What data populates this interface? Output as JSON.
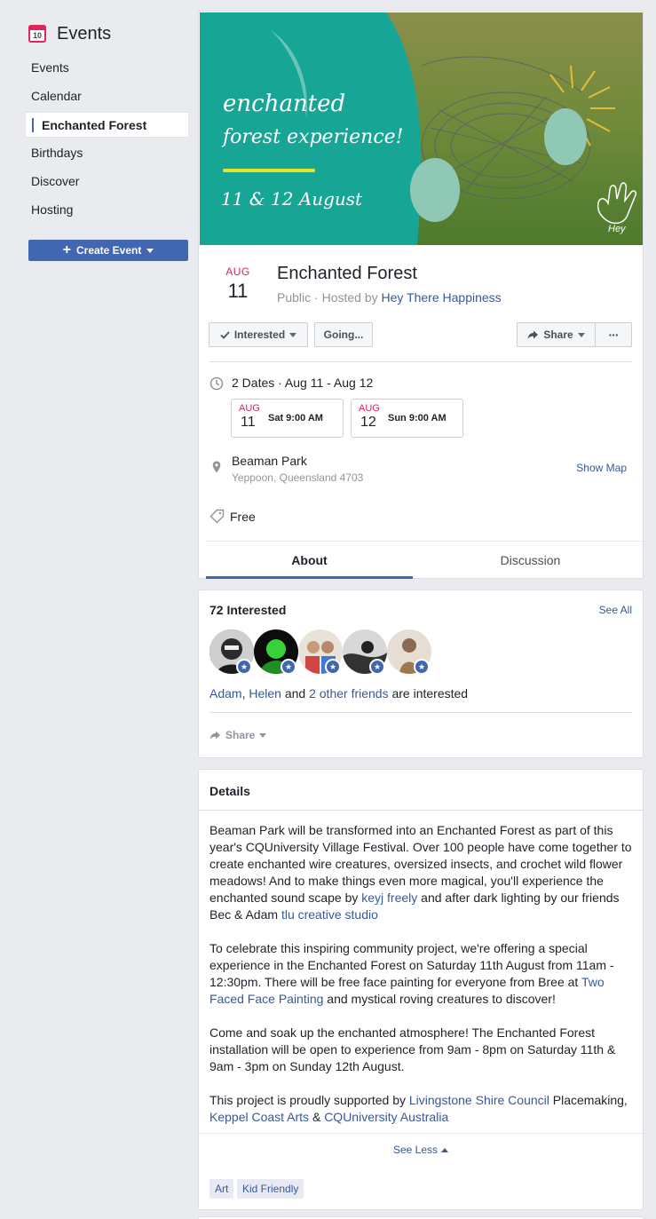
{
  "sidebar": {
    "title": "Events",
    "icon_day": "10",
    "items": [
      {
        "label": "Events"
      },
      {
        "label": "Calendar"
      },
      {
        "label": "Enchanted Forest"
      },
      {
        "label": "Birthdays"
      },
      {
        "label": "Discover"
      },
      {
        "label": "Hosting"
      }
    ],
    "create_label": "Create Event"
  },
  "event": {
    "cover": {
      "line1": "enchanted",
      "line2": "forest experience!",
      "dates": "11 & 12 August",
      "logo_text": "Hey"
    },
    "month": "AUG",
    "day": "11",
    "title": "Enchanted Forest",
    "privacy": "Public",
    "hosted_prefix": " · Hosted by ",
    "host": "Hey There Happiness",
    "buttons": {
      "interested": "Interested",
      "going": "Going...",
      "share": "Share",
      "more": "···"
    },
    "dates_summary": "2 Dates · Aug 11 - Aug 12",
    "dates": [
      {
        "month": "AUG",
        "day": "11",
        "time": "Sat 9:00 AM"
      },
      {
        "month": "AUG",
        "day": "12",
        "time": "Sun 9:00 AM"
      }
    ],
    "location": {
      "name": "Beaman Park",
      "address": "Yeppoon, Queensland 4703",
      "map_label": "Show Map"
    },
    "price": "Free",
    "tabs": [
      {
        "label": "About"
      },
      {
        "label": "Discussion"
      }
    ]
  },
  "interested": {
    "title": "72 Interested",
    "see_all": "See All",
    "friend1": "Adam",
    "sep": ", ",
    "friend2": "Helen",
    "and": " and ",
    "others": "2 other friends",
    "suffix": " are interested",
    "share": "Share"
  },
  "details": {
    "title": "Details",
    "p1_a": "Beaman Park will be transformed into an Enchanted Forest as part of this year's CQUniversity Village Festival. Over 100 people have come together to create enchanted wire creatures, oversized insects, and crochet wild flower meadows! And to make things even more magical, you'll experience the enchanted sound scape by ",
    "p1_link1": "keyj freely",
    "p1_b": " and after dark lighting by our friends Bec & Adam ",
    "p1_link2": "tlu creative studio",
    "p2_a": "To celebrate this inspiring community project, we're offering a special experience in the Enchanted Forest on Saturday 11th August from 11am - 12:30pm. There will be free face painting for everyone from Bree at ",
    "p2_link": "Two Faced Face Painting",
    "p2_b": " and mystical roving creatures to discover!",
    "p3": "Come and soak up the enchanted atmosphere! The Enchanted Forest installation will be open to experience from 9am - 8pm on Saturday 11th & 9am - 3pm on Sunday 12th August.",
    "p4_a": "This project is proudly supported by ",
    "p4_link1": "Livingstone Shire Council",
    "p4_b": " Placemaking, ",
    "p4_link2": "Keppel Coast Arts",
    "p4_c": " & ",
    "p4_link3": "CQUniversity Australia",
    "see_less": "See Less",
    "tags": [
      {
        "label": "Art"
      },
      {
        "label": "Kid Friendly"
      }
    ]
  },
  "colors": {
    "accent": "#4267b2",
    "link": "#385898",
    "date_red": "#e0245e",
    "cover_teal": "#1aa59a"
  }
}
